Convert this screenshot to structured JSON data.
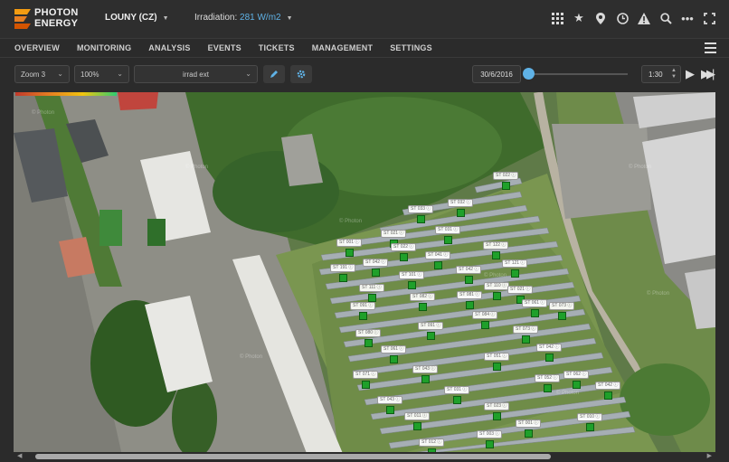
{
  "brand": {
    "line1": "PHOTON",
    "line2": "ENERGY"
  },
  "site": {
    "name": "LOUNY (CZ)"
  },
  "irradiation": {
    "label": "Irradiation:",
    "value": "281 W/m2"
  },
  "top_icons": [
    "grid-icon",
    "star-icon",
    "location-pin-icon",
    "clock-icon",
    "warning-icon",
    "search-icon",
    "more-icon",
    "fullscreen-icon"
  ],
  "nav": {
    "items": [
      "OVERVIEW",
      "MONITORING",
      "ANALYSIS",
      "EVENTS",
      "TICKETS",
      "MANAGEMENT",
      "SETTINGS"
    ]
  },
  "toolbar": {
    "zoom": "Zoom 3",
    "scale": "100%",
    "layer": "irrad ext",
    "date": "30/6/2016",
    "time": "1:30",
    "timeline_position": 0.0
  },
  "colors": {
    "accent": "#5fb2e6",
    "marker": "#1fa02a",
    "background": "#2b2b2b"
  },
  "map": {
    "watermark": "© Photon",
    "labels": [
      "ST 022",
      "ST 033",
      "ST 032",
      "ST 031",
      "ST 021",
      "ST 001",
      "ST 022",
      "ST 122",
      "ST 042",
      "ST 191",
      "ST 121",
      "ST 041",
      "ST 111",
      "ST 101",
      "ST 042",
      "ST 110",
      "ST 091",
      "ST 082",
      "ST 081",
      "ST 021",
      "ST 080",
      "ST 091",
      "ST 084",
      "ST 061",
      "ST 073",
      "ST 061",
      "ST 073",
      "ST 042",
      "ST 071",
      "ST 043",
      "ST 051",
      "ST 062",
      "ST 043",
      "ST 031",
      "ST 052",
      "ST 042",
      "ST 011",
      "ST 023",
      "ST 010",
      "ST 001",
      "ST 012",
      "ST 003"
    ]
  }
}
